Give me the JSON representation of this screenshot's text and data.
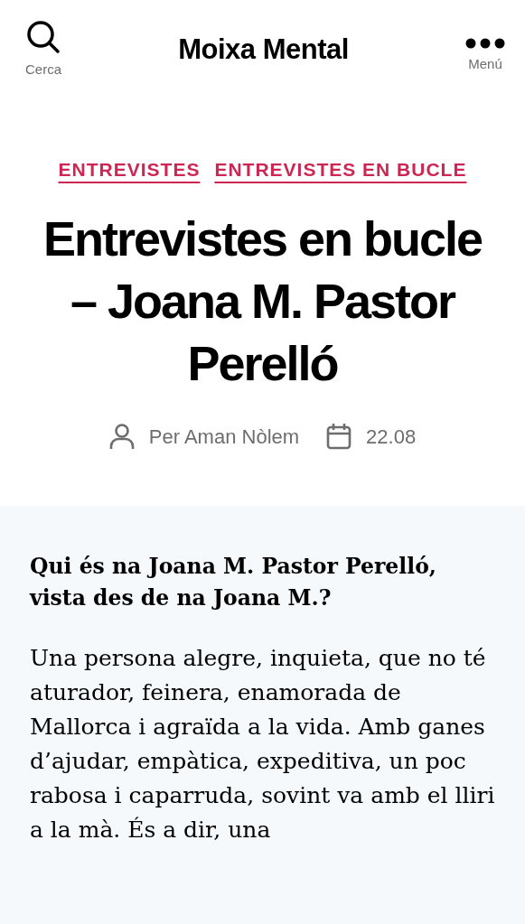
{
  "header": {
    "site_title": "Moixa Mental",
    "search_label": "Cerca",
    "menu_label": "Menú"
  },
  "categories": [
    "ENTREVISTES",
    "ENTREVISTES EN BUCLE"
  ],
  "title": "Entrevistes en bucle – Joana M. Pastor Perelló",
  "meta": {
    "author": "Per Aman Nòlem",
    "date": "22.08"
  },
  "content": [
    {
      "kind": "question",
      "text": "Qui és na Joana M. Pastor Perelló, vista des de na Joana M.?"
    },
    {
      "kind": "paragraph",
      "text": "Una persona alegre, inquieta, que no té aturador, feinera, enamorada de Mallorca i agraïda a la vida. Amb ganes d’ajudar, empàtica, expeditiva, un poc rabosa i caparruda, sovint va amb el lliri a la mà. És a dir, una"
    }
  ]
}
